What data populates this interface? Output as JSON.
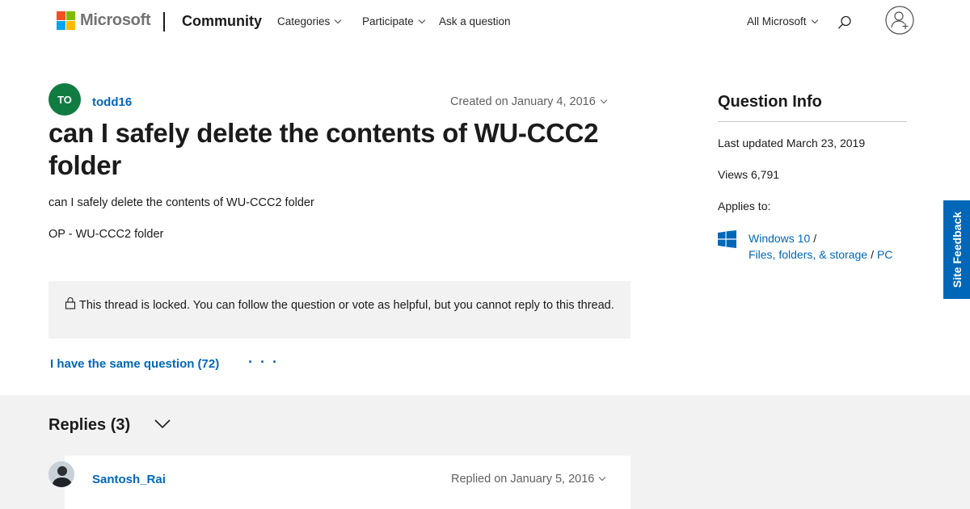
{
  "header": {
    "brand": "Microsoft",
    "section": "Community",
    "nav": [
      "Categories",
      "Participate",
      "Ask a question"
    ],
    "all_microsoft": "All Microsoft",
    "logo_colors": [
      "#f25022",
      "#7fba00",
      "#00a4ef",
      "#ffb900"
    ]
  },
  "question": {
    "avatar_initials": "TO",
    "author": "todd16",
    "created": "Created on January 4, 2016",
    "title": "can I safely delete the contents of WU-CCC2 folder",
    "body": "can I safely delete the contents of WU-CCC2 folder",
    "body2": "OP - WU-CCC2 folder",
    "locked_notice": "This thread is locked. You can follow the question or vote as helpful, but you cannot reply to this thread.",
    "same_question": "I have the same question (72)",
    "more": "· · ·"
  },
  "question_info": {
    "title": "Question Info",
    "last_updated": "Last updated March 23, 2019",
    "views": "Views 6,791",
    "applies_label": "Applies to:",
    "applies": [
      "Windows 10",
      "Files, folders, & storage",
      "PC"
    ],
    "separator": "/"
  },
  "site_feedback": "Site Feedback",
  "replies": {
    "title": "Replies (3)",
    "items": [
      {
        "author": "Santosh_Rai",
        "date": "Replied on January 5, 2016"
      }
    ]
  },
  "colors": {
    "accent": "#0067b8",
    "avatar_bg": "#107c41",
    "band_bg": "#f2f2f2"
  }
}
